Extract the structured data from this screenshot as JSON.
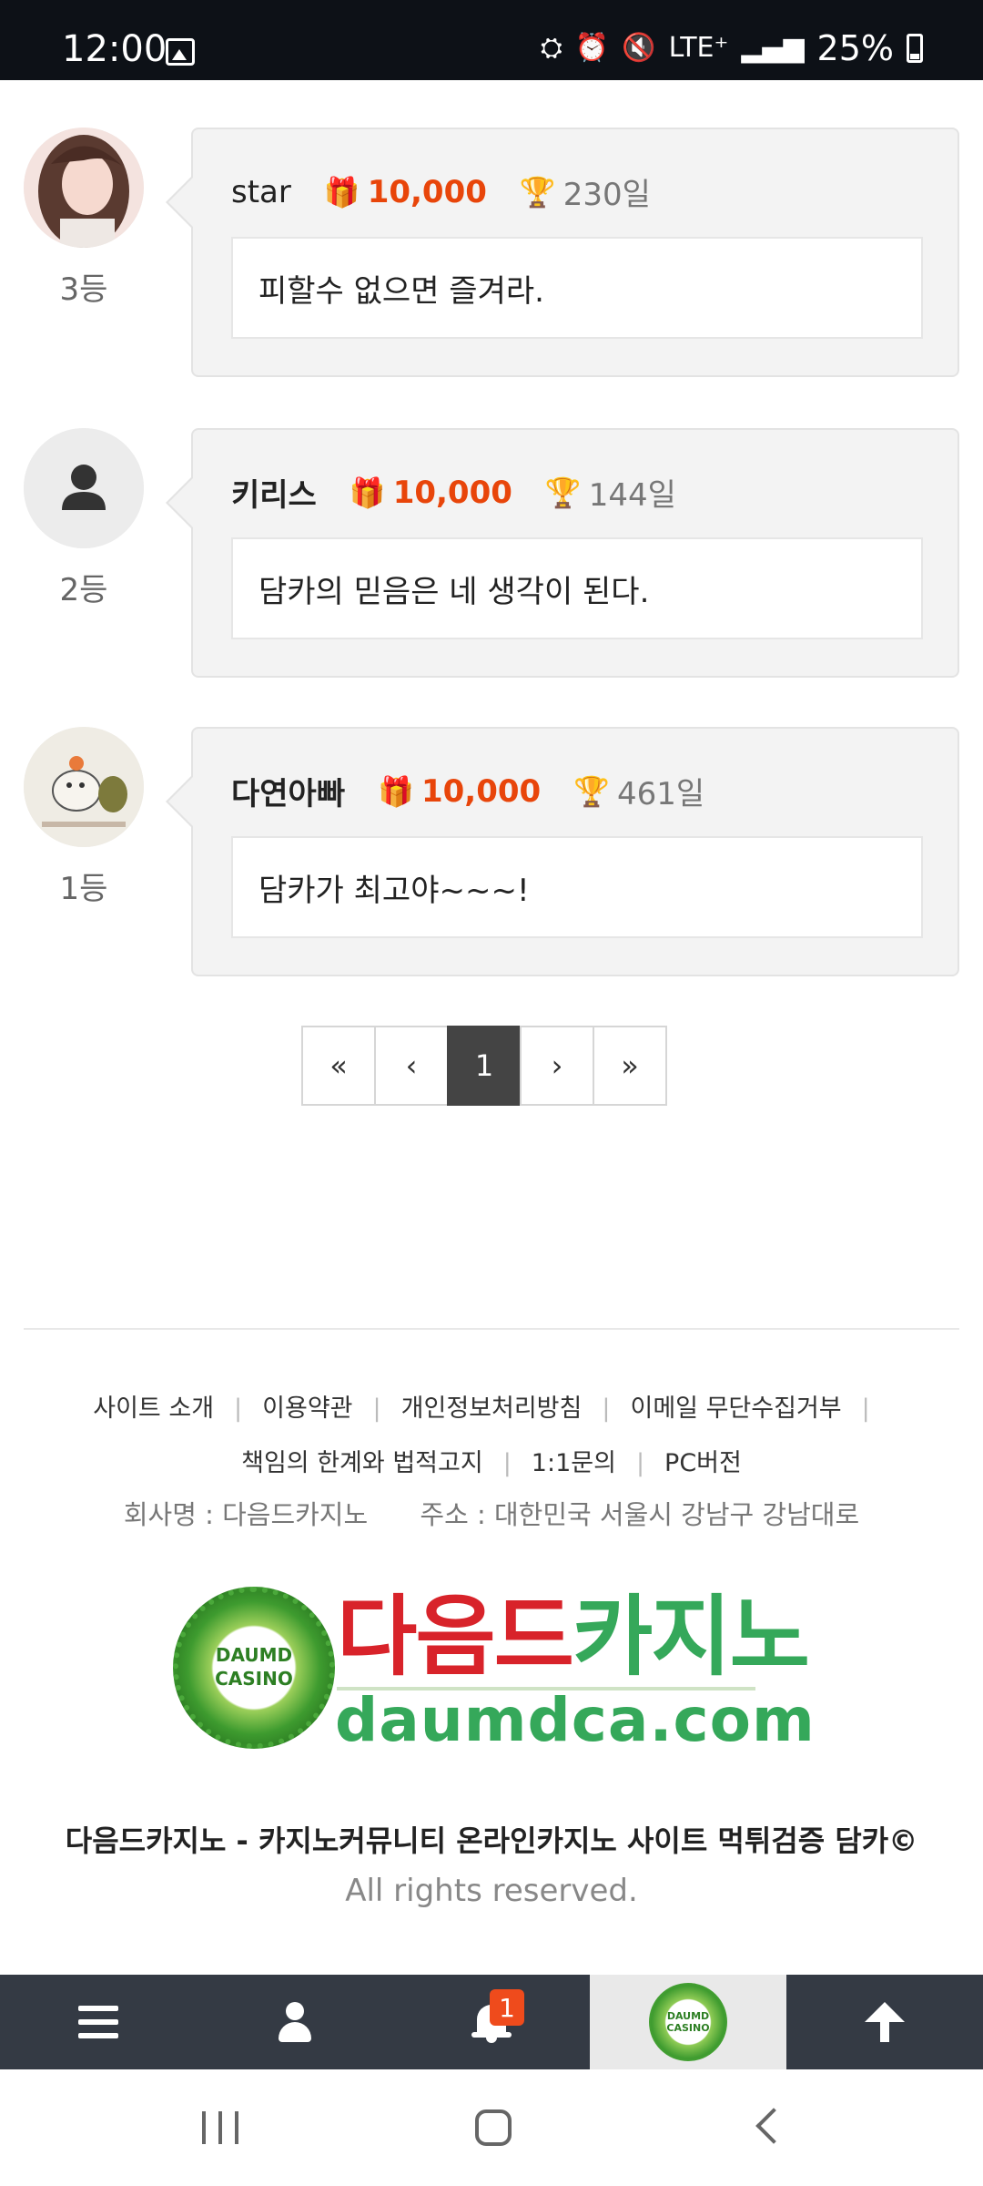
{
  "status_bar": {
    "time": "12:00",
    "network": "LTE⁺",
    "battery": "25%",
    "icons": [
      "image-icon",
      "battery-saver-icon",
      "alarm-icon",
      "mute-icon",
      "lte-icon",
      "signal-icon",
      "battery-icon"
    ]
  },
  "rankings": [
    {
      "rank": "3등",
      "nickname": "star",
      "points": "10,000",
      "days": "230일",
      "message": "피할수 없으면 즐겨라.",
      "avatar": "photo-avatar-woman"
    },
    {
      "rank": "2등",
      "nickname": "키리스",
      "points": "10,000",
      "days": "144일",
      "message": "담카의 믿음은 네 생각이 된다.",
      "avatar": "default-user-avatar"
    },
    {
      "rank": "1등",
      "nickname": "다연아빠",
      "points": "10,000",
      "days": "461일",
      "message": "담카가 최고야~~~!",
      "avatar": "photo-avatar-hamster-drawing"
    }
  ],
  "pagination": {
    "first": "«",
    "prev": "‹",
    "current": "1",
    "next": "›",
    "last": "»"
  },
  "footer": {
    "links_row1": [
      "사이트 소개",
      "이용약관",
      "개인정보처리방침",
      "이메일 무단수집거부"
    ],
    "links_row2": [
      "책임의 한계와 법적고지",
      "1:1문의",
      "PC버전"
    ],
    "company": "회사명 : 다음드카지노",
    "address": "주소 : 대한민국 서울시 강남구 강남대로",
    "logo": {
      "title_red": "다음드",
      "title_green": "카지노",
      "url": "daumdca.com",
      "badge_line1": "DAUMD",
      "badge_line2": "CASINO"
    },
    "copyright": "다음드카지노 - 카지노커뮤니티 온라인카지노 사이트 먹튀검증 담카©",
    "rights": "All rights reserved."
  },
  "bottom_nav": {
    "items": [
      "menu-icon",
      "user-icon",
      "bell-icon",
      "home-logo",
      "scroll-top-icon"
    ],
    "notification_count": "1",
    "logo_line1": "DAUMD",
    "logo_line2": "CASINO"
  },
  "colors": {
    "accent_points": "#e8450a",
    "status_bar": "#0d1117",
    "bottom_nav": "#343a44",
    "active_page": "#444444",
    "logo_red": "#d8232a",
    "logo_green": "#35a85a",
    "badge": "#ef4b1c"
  }
}
